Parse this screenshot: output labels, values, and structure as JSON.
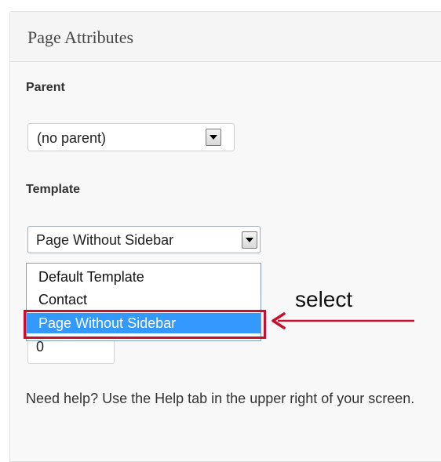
{
  "panel": {
    "title": "Page Attributes"
  },
  "parent": {
    "label": "Parent",
    "selected": "(no parent)"
  },
  "template": {
    "label": "Template",
    "selected": "Page Without Sidebar",
    "options": [
      {
        "label": "Default Template"
      },
      {
        "label": "Contact"
      },
      {
        "label": "Page Without Sidebar"
      }
    ]
  },
  "order": {
    "value": "0"
  },
  "help": {
    "text": "Need help? Use the Help tab in the upper right of your screen."
  },
  "annotation": {
    "text": "select",
    "color": "#c8102e"
  },
  "colors": {
    "selection": "#3399ff",
    "panel_bg": "#f8f8f8"
  }
}
